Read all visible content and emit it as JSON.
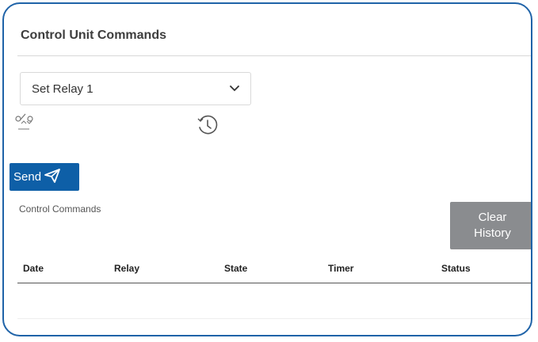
{
  "panel": {
    "title": "Control Unit Commands"
  },
  "command_select": {
    "selected": "Set Relay 1"
  },
  "icons": {
    "relay": "relay-switch-icon",
    "timer": "clock-icon",
    "send": "paper-plane-icon",
    "select_caret": "chevron-down-icon"
  },
  "send_button": {
    "label": "Send"
  },
  "history": {
    "section_label": "Control Commands",
    "clear_label": "Clear\nHistory",
    "columns": [
      "Date",
      "Relay",
      "State",
      "Timer",
      "Status"
    ],
    "rows": []
  },
  "colors": {
    "border": "#1f63a8",
    "send_button": "#0e5fa7",
    "clear_button": "#8a8c8f"
  }
}
